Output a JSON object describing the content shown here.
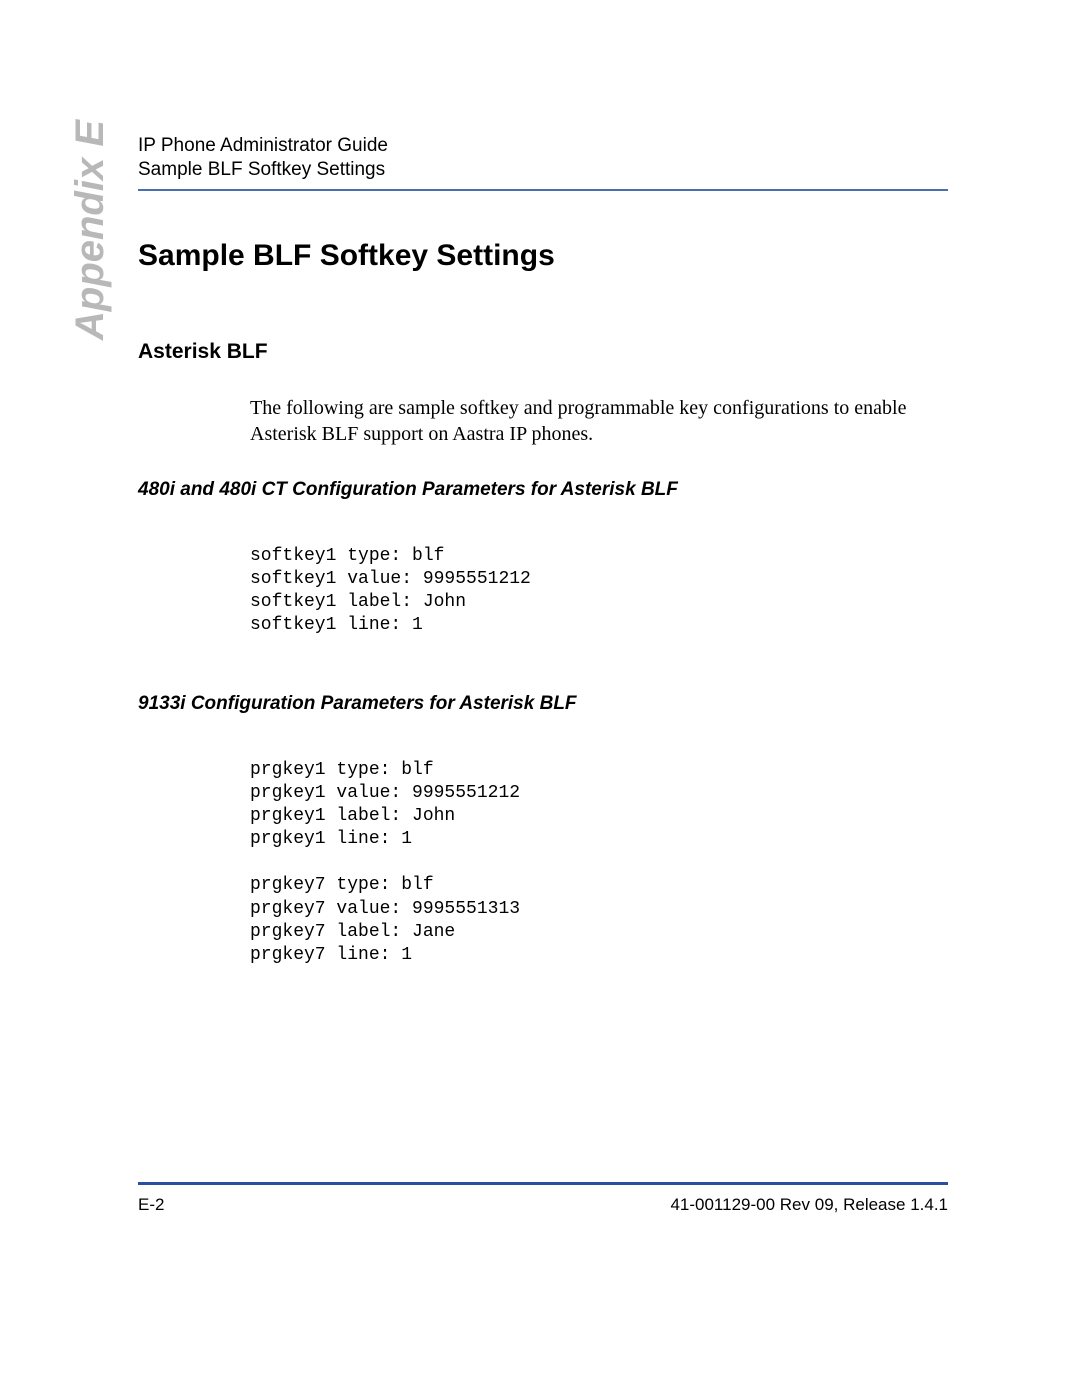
{
  "header": {
    "line1": "IP Phone Administrator Guide",
    "line2": "Sample BLF Softkey Settings"
  },
  "appendix_label": "Appendix E",
  "main_title": "Sample BLF Softkey Settings",
  "section1": {
    "heading": "Asterisk BLF",
    "body": "The following are sample softkey and programmable key configurations to enable Asterisk BLF support on Aastra IP phones."
  },
  "subsection1": {
    "heading": "480i and 480i CT Configuration Parameters for Asterisk BLF",
    "code": "softkey1 type: blf\nsoftkey1 value: 9995551212\nsoftkey1 label: John\nsoftkey1 line: 1"
  },
  "subsection2": {
    "heading": "9133i Configuration Parameters for Asterisk BLF",
    "code": "prgkey1 type: blf\nprgkey1 value: 9995551212\nprgkey1 label: John\nprgkey1 line: 1\n\nprgkey7 type: blf\nprgkey7 value: 9995551313\nprgkey7 label: Jane\nprgkey7 line: 1"
  },
  "footer": {
    "page": "E-2",
    "doc_info": "41-001129-00 Rev 09, Release 1.4.1"
  }
}
